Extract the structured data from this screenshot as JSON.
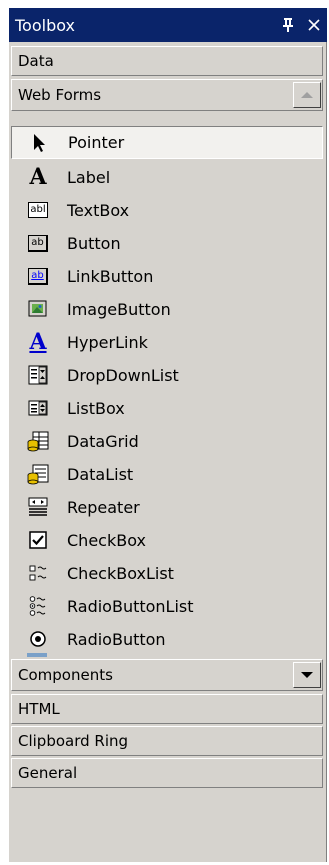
{
  "window": {
    "title": "Toolbox",
    "pin_glyph": "I",
    "close_glyph": "✕"
  },
  "tabs_top": [
    {
      "label": "Data"
    },
    {
      "label": "Web Forms"
    }
  ],
  "items": [
    {
      "label": "Pointer",
      "icon": "pointer-icon",
      "selected": true
    },
    {
      "label": "Label",
      "icon": "label-icon"
    },
    {
      "label": "TextBox",
      "icon": "textbox-icon",
      "icon_text": "abl"
    },
    {
      "label": "Button",
      "icon": "button-icon",
      "icon_text": "ab"
    },
    {
      "label": "LinkButton",
      "icon": "linkbutton-icon",
      "icon_text": "ab"
    },
    {
      "label": "ImageButton",
      "icon": "imagebutton-icon"
    },
    {
      "label": "HyperLink",
      "icon": "hyperlink-icon"
    },
    {
      "label": "DropDownList",
      "icon": "dropdownlist-icon"
    },
    {
      "label": "ListBox",
      "icon": "listbox-icon"
    },
    {
      "label": "DataGrid",
      "icon": "datagrid-icon"
    },
    {
      "label": "DataList",
      "icon": "datalist-icon"
    },
    {
      "label": "Repeater",
      "icon": "repeater-icon"
    },
    {
      "label": "CheckBox",
      "icon": "checkbox-icon"
    },
    {
      "label": "CheckBoxList",
      "icon": "checkboxlist-icon"
    },
    {
      "label": "RadioButtonList",
      "icon": "radiobuttonlist-icon"
    },
    {
      "label": "RadioButton",
      "icon": "radiobutton-icon"
    }
  ],
  "tabs_bottom": [
    {
      "label": "Components"
    },
    {
      "label": "HTML"
    },
    {
      "label": "Clipboard Ring"
    },
    {
      "label": "General"
    }
  ],
  "colors": {
    "titlebar": "#0a246a",
    "panel": "#d6d3ce",
    "selected": "#f2f1ee"
  }
}
